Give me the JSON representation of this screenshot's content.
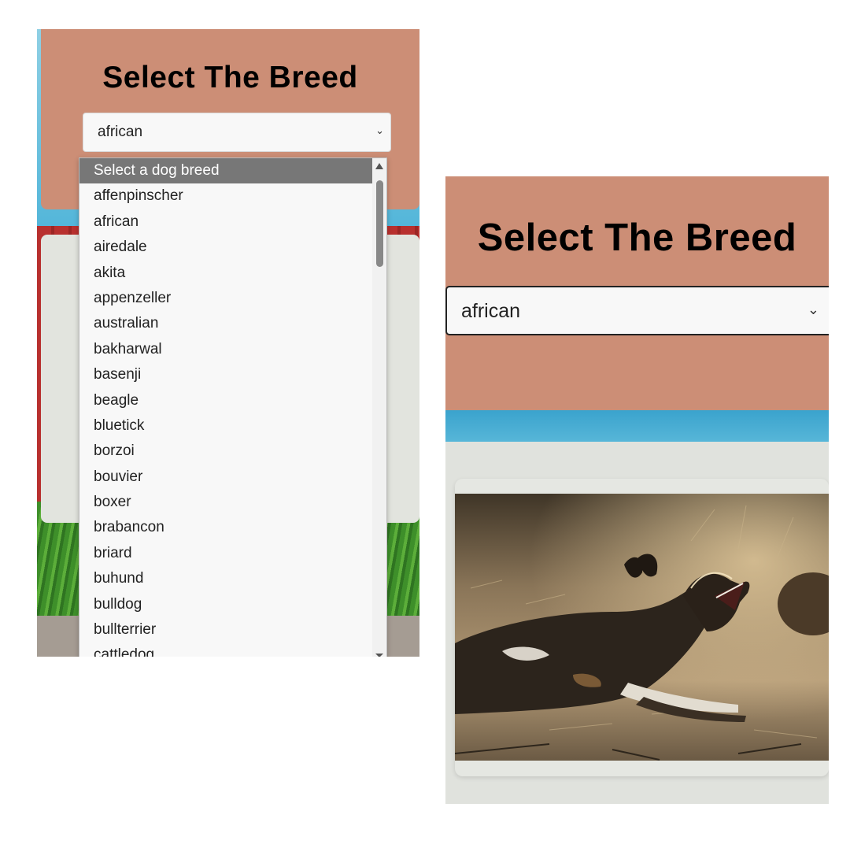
{
  "left": {
    "title": "Select The Breed",
    "select_value": "african",
    "dropdown_options": [
      "Select a dog breed",
      "affenpinscher",
      "african",
      "airedale",
      "akita",
      "appenzeller",
      "australian",
      "bakharwal",
      "basenji",
      "beagle",
      "bluetick",
      "borzoi",
      "bouvier",
      "boxer",
      "brabancon",
      "briard",
      "buhund",
      "bulldog",
      "bullterrier",
      "cattledog"
    ],
    "highlighted_option": "Select a dog breed"
  },
  "right": {
    "title": "Select The Breed",
    "select_value": "african",
    "image_subject": "african wild dog yawning"
  },
  "colors": {
    "header_bg": "#cc8e76",
    "content_bg": "#e2e4de",
    "highlight_option": "#777777"
  }
}
